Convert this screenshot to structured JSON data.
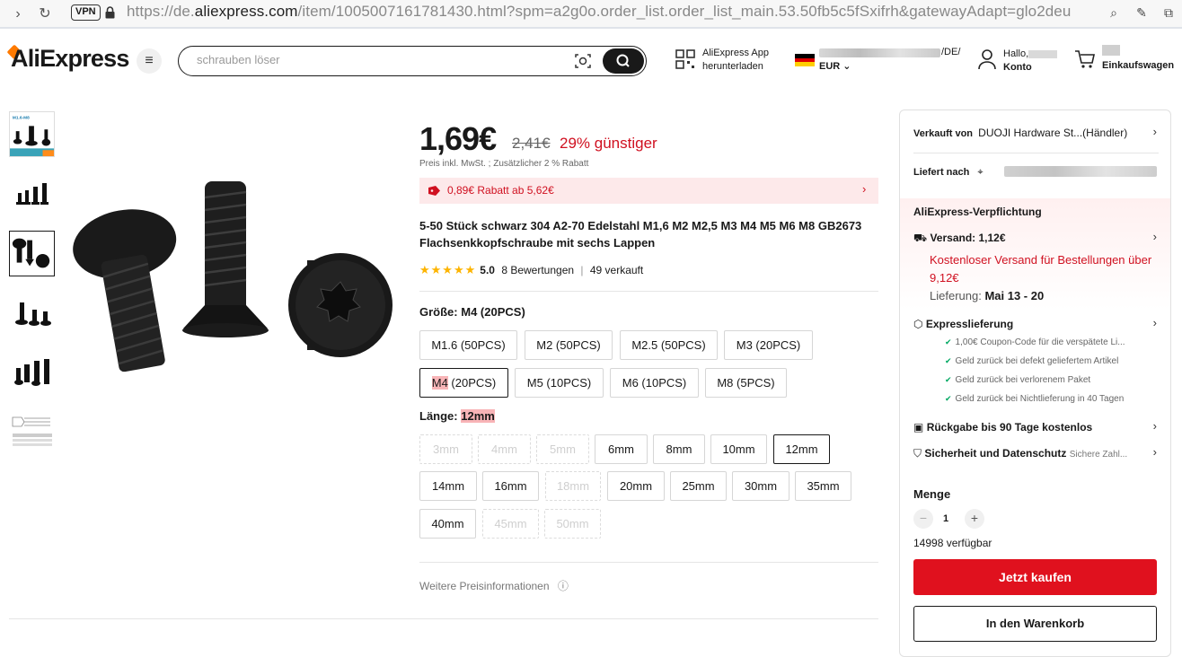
{
  "browser": {
    "vpn": "VPN",
    "url_prefix": "https://de.",
    "url_host": "aliexpress.com",
    "url_path": "/item/1005007161781430.html?spm=a2g0o.order_list.order_list_main.53.50fb5c5fSxifrh&gatewayAdapt=glo2deu"
  },
  "header": {
    "logo": "AliExpress",
    "search_placeholder": "schrauben löser",
    "app_line1": "AliExpress App",
    "app_line2": "herunterladen",
    "locale_suffix": "/DE/",
    "currency": "EUR",
    "hello": "Hallo,",
    "account": "Konto",
    "cart": "Einkaufswagen"
  },
  "product": {
    "price": "1,69€",
    "old_price": "2,41€",
    "discount": "29% günstiger",
    "price_note": "Preis inkl. MwSt. ; Zusätzlicher 2 % Rabatt",
    "coupon": "0,89€ Rabatt ab 5,62€",
    "title": "5-50 Stück schwarz 304 A2-70 Edelstahl M1,6 M2 M2,5 M3 M4 M5 M6 M8 GB2673 Flachsenkkopfschraube mit sechs Lappen",
    "rating_value": "5.0",
    "reviews": "8 Bewertungen",
    "sold": "49 verkauft",
    "size_label": "Größe:",
    "size_selected": "M4 (20PCS)",
    "sizes": [
      {
        "label": "M1.6 (50PCS)"
      },
      {
        "label": "M2 (50PCS)"
      },
      {
        "label": "M2.5 (50PCS)"
      },
      {
        "label": "M3 (20PCS)"
      },
      {
        "label_hl": "M4",
        "label_rest": " (20PCS)"
      },
      {
        "label": "M5 (10PCS)"
      },
      {
        "label": "M6 (10PCS)"
      },
      {
        "label": "M8 (5PCS)"
      }
    ],
    "length_label": "Länge:",
    "length_selected": "12mm",
    "lengths": [
      "3mm",
      "4mm",
      "5mm",
      "6mm",
      "8mm",
      "10mm",
      "12mm",
      "14mm",
      "16mm",
      "18mm",
      "20mm",
      "25mm",
      "30mm",
      "35mm",
      "40mm",
      "45mm",
      "50mm"
    ],
    "more_price_info": "Weitere Preisinformationen",
    "thumb_label": "M1.6-M8"
  },
  "panel": {
    "sold_by_label": "Verkauft von",
    "sold_by": "DUOJI Hardware St...(Händler)",
    "ship_to_label": "Liefert nach",
    "commitment": "AliExpress-Verpflichtung",
    "shipping": "Versand: 1,12€",
    "free_shipping": "Kostenloser Versand für Bestellungen über 9,12€",
    "delivery_label": "Lieferung:",
    "delivery_date": "Mai 13 - 20",
    "express": "Expresslieferung",
    "guarantees": [
      "1,00€ Coupon-Code für die verspätete Li...",
      "Geld zurück bei defekt geliefertem Artikel",
      "Geld zurück bei verlorenem Paket",
      "Geld zurück bei Nichtlieferung in 40 Tagen"
    ],
    "returns": "Rückgabe bis 90 Tage kostenlos",
    "security": "Sicherheit und Datenschutz",
    "security_note": "Sichere Zahl...",
    "qty_title": "Menge",
    "qty_value": "1",
    "available": "14998 verfügbar",
    "buy_now": "Jetzt kaufen",
    "add_to_cart": "In den Warenkorb"
  }
}
